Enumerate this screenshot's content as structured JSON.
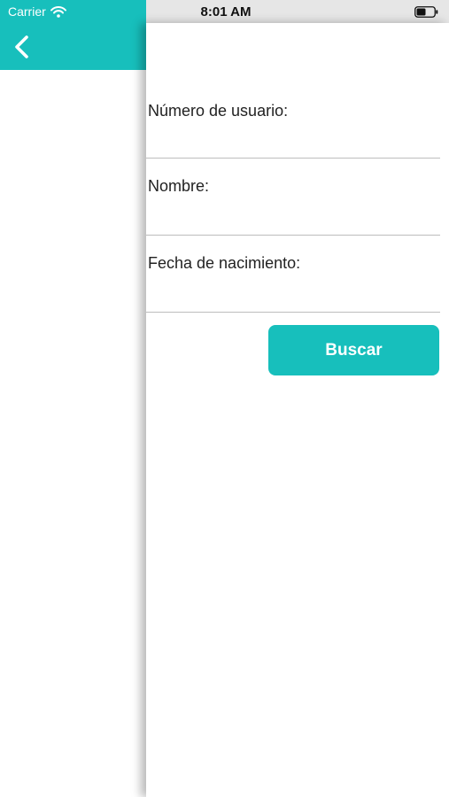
{
  "status_bar": {
    "carrier": "Carrier",
    "time": "8:01 AM",
    "wifi_icon": "wifi-icon",
    "battery_icon": "battery-icon"
  },
  "back_screen": {
    "back_icon": "chevron-left-icon",
    "header_color": "#17bfbc"
  },
  "form": {
    "fields": [
      {
        "label": "Número de usuario:",
        "value": ""
      },
      {
        "label": "Nombre:",
        "value": ""
      },
      {
        "label": "Fecha de nacimiento:",
        "value": ""
      }
    ],
    "submit_label": "Buscar"
  },
  "colors": {
    "accent": "#17bfbc",
    "divider": "#bdbdbd"
  }
}
